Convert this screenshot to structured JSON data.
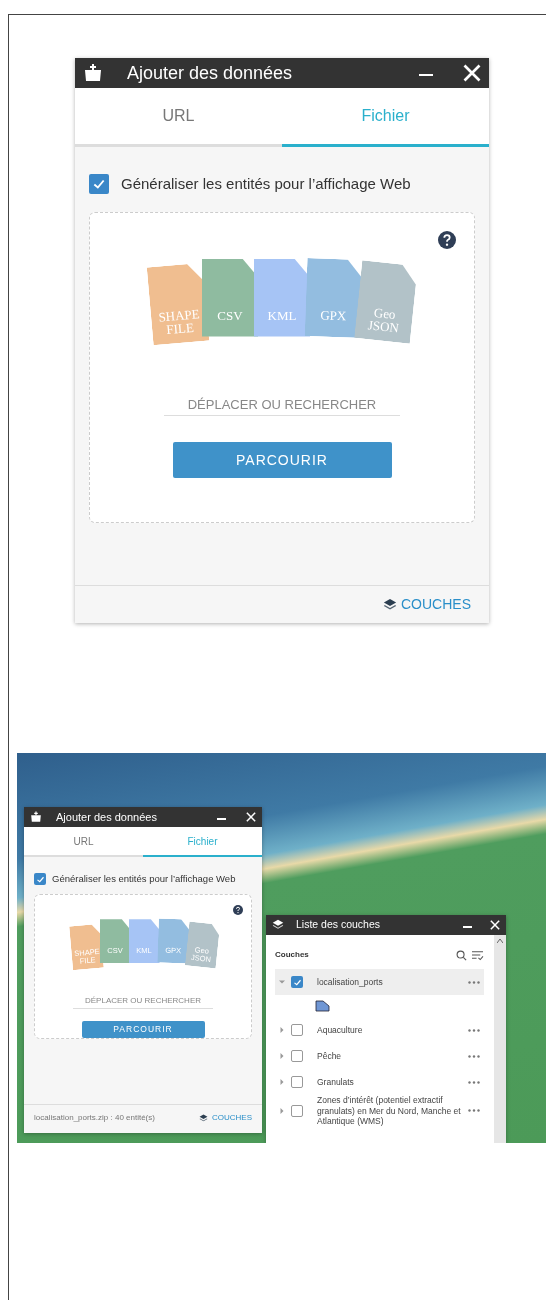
{
  "dialog_large": {
    "title": "Ajouter des données",
    "tabs": [
      {
        "label": "URL",
        "selected": false
      },
      {
        "label": "Fichier",
        "selected": true
      }
    ],
    "generalize": {
      "label": "Généraliser les entités pour l’affichage Web",
      "checked": true
    },
    "file_types": [
      {
        "label": "SHAPE FILE",
        "color": "#f0be90"
      },
      {
        "label": "CSV",
        "color": "#8fbba0"
      },
      {
        "label": "KML",
        "color": "#a6c4f5"
      },
      {
        "label": "GPX",
        "color": "#93bde0"
      },
      {
        "label": "Geo JSON",
        "color": "#b2c2c8"
      }
    ],
    "drop_hint": "DÉPLACER OU RECHERCHER",
    "browse_button": "PARCOURIR",
    "layers_link": "COUCHES"
  },
  "map_view": {
    "dialog": {
      "title": "Ajouter des données",
      "tabs": [
        {
          "label": "URL",
          "selected": false
        },
        {
          "label": "Fichier",
          "selected": true
        }
      ],
      "generalize": {
        "label": "Généraliser les entités pour l’affichage Web",
        "checked": true
      },
      "file_types": [
        {
          "label": "SHAPE FILE",
          "color": "#f0be90"
        },
        {
          "label": "CSV",
          "color": "#8fbba0"
        },
        {
          "label": "KML",
          "color": "#a6c4f5"
        },
        {
          "label": "GPX",
          "color": "#93bde0"
        },
        {
          "label": "Geo JSON",
          "color": "#b2c2c8"
        }
      ],
      "drop_hint": "DÉPLACER OU RECHERCHER",
      "browse_button": "PARCOURIR",
      "status": "localisation_ports.zip : 40 entité(s)",
      "layers_link": "COUCHES"
    },
    "layer_list": {
      "title": "Liste des couches",
      "header": "Couches",
      "layers": [
        {
          "name": "localisation_ports",
          "checked": true,
          "expanded": true,
          "selected": true
        },
        {
          "name": "Aquaculture",
          "checked": false,
          "expanded": false,
          "selected": false
        },
        {
          "name": "Pêche",
          "checked": false,
          "expanded": false,
          "selected": false
        },
        {
          "name": "Granulats",
          "checked": false,
          "expanded": false,
          "selected": false
        },
        {
          "name": "Zones d’intérêt (potentiel extractif granulats) en Mer du Nord, Manche et Atlantique (WMS)",
          "checked": false,
          "expanded": false,
          "selected": false
        }
      ]
    }
  }
}
